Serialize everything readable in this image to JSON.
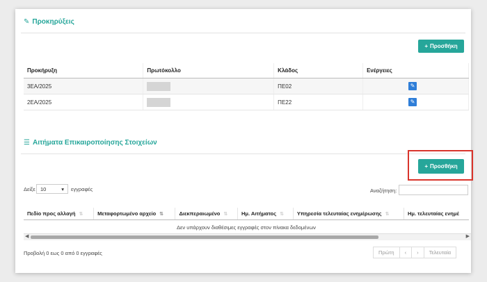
{
  "section1": {
    "title": "Προκηρύξεις",
    "add_label": "Προσθήκη",
    "columns": [
      "Προκήρυξη",
      "Πρωτόκολλο",
      "Κλάδος",
      "Ενέργειες"
    ],
    "rows": [
      {
        "code": "3ΕΑ/2025",
        "klados": "ΠΕ02"
      },
      {
        "code": "2ΕΑ/2025",
        "klados": "ΠΕ22"
      }
    ]
  },
  "section2": {
    "title": "Αιτήματα Επικαιροποίησης Στοιχείων",
    "add_label": "Προσθήκη",
    "show_prefix": "Δείξε",
    "page_size": "10",
    "show_suffix": "εγγραφές",
    "search_label": "Αναζήτηση:",
    "columns": [
      "Πεδίο προς αλλαγή",
      "Μεταφορτωμένο αρχείο",
      "Διεκπεραιωμένο",
      "Ημ. Αιτήματος",
      "Υπηρεσία τελευταίας ενημέρωσης",
      "Ημ. τελευταίας ενημέ"
    ],
    "empty_message": "Δεν υπάρχουν διαθέσιμες εγγραφές στον πίνακα δεδομένων",
    "info": "Προβολή 0 εως 0 από 0 εγγραφές",
    "pager": {
      "first": "Πρώτη",
      "prev": "‹",
      "next": "›",
      "last": "Τελευταία"
    }
  },
  "colors": {
    "accent": "#26a69a",
    "edit": "#2f7ed8",
    "highlight": "#d9342b"
  },
  "icons": {
    "section1": "bookmark-icon",
    "section2": "list-icon",
    "edit": "pencil-icon"
  }
}
